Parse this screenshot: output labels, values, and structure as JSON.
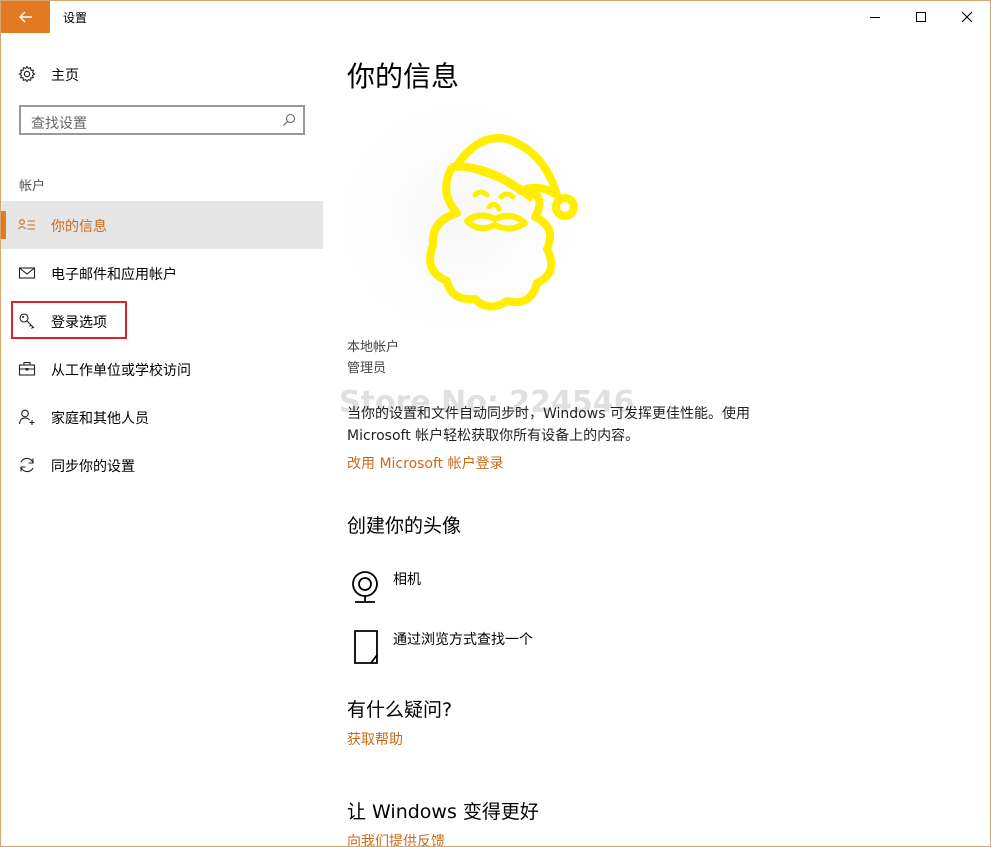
{
  "window": {
    "title": "设置",
    "colors": {
      "accent": "#e07b24",
      "link": "#c96a1b",
      "highlight_border": "#d9262c"
    }
  },
  "sidebar": {
    "home_label": "主页",
    "search_placeholder": "查找设置",
    "section_label": "帐户",
    "items": [
      {
        "label": "你的信息",
        "icon": "person-list-icon",
        "active": true
      },
      {
        "label": "电子邮件和应用帐户",
        "icon": "mail-icon",
        "active": false
      },
      {
        "label": "登录选项",
        "icon": "key-icon",
        "active": false,
        "highlighted": true
      },
      {
        "label": "从工作单位或学校访问",
        "icon": "briefcase-icon",
        "active": false
      },
      {
        "label": "家庭和其他人员",
        "icon": "person-add-icon",
        "active": false
      },
      {
        "label": "同步你的设置",
        "icon": "sync-icon",
        "active": false
      }
    ]
  },
  "main": {
    "title": "你的信息",
    "account_type": "本地帐户",
    "account_role": "管理员",
    "watermark": "Store No: 224546",
    "description": "当你的设置和文件自动同步时，Windows 可发挥更佳性能。使用 Microsoft 帐户轻松获取你所有设备上的内容。",
    "ms_login_link": "改用 Microsoft 帐户登录",
    "create_avatar_heading": "创建你的头像",
    "camera_label": "相机",
    "browse_label": "通过浏览方式查找一个",
    "question_heading": "有什么疑问?",
    "help_link": "获取帮助",
    "better_heading": "让 Windows 变得更好",
    "feedback_link": "向我们提供反馈"
  }
}
